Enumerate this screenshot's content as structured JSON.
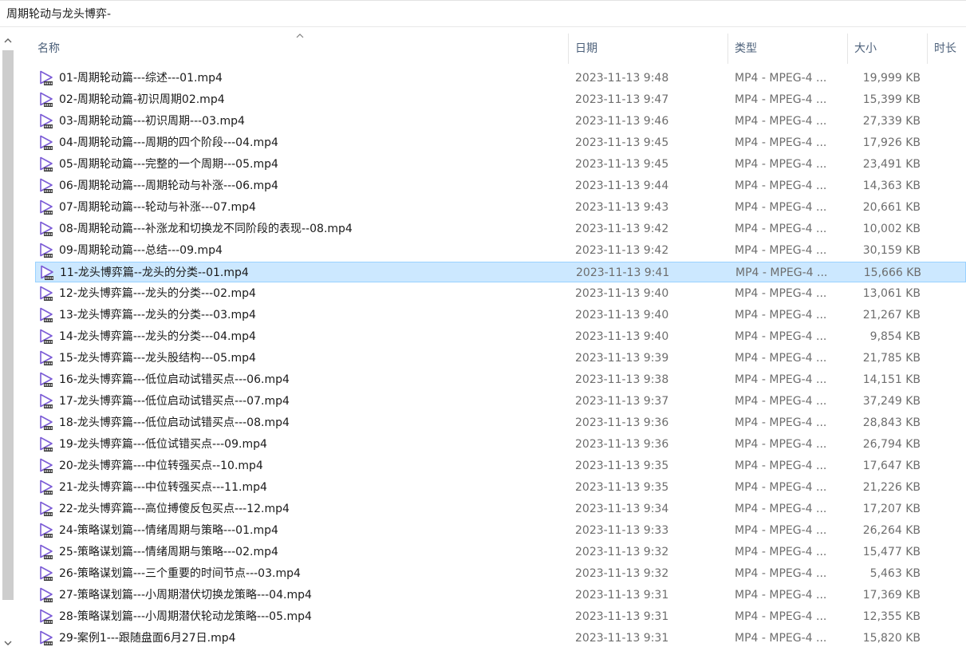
{
  "window": {
    "path_title": "周期轮动与龙头博弈-"
  },
  "columns": {
    "name": "名称",
    "date": "日期",
    "type": "类型",
    "size": "大小",
    "duration": "时长"
  },
  "colors": {
    "selected_bg": "#cce8ff",
    "selected_border": "#99d1ff",
    "header_text": "#4c607a",
    "icon_purple": "#7b5bd6"
  },
  "icons": {
    "file": "video-file-icon",
    "sort": "sort-up-arrow-icon",
    "scroll_up": "chevron-up-icon",
    "scroll_down": "chevron-down-icon"
  },
  "files": [
    {
      "name": "01-周期轮动篇---综述---01.mp4",
      "date": "2023-11-13 9:48",
      "type": "MP4 - MPEG-4 ...",
      "size": "19,999 KB"
    },
    {
      "name": "02-周期轮动篇-初识周期02.mp4",
      "date": "2023-11-13 9:47",
      "type": "MP4 - MPEG-4 ...",
      "size": "15,399 KB"
    },
    {
      "name": "03-周期轮动篇---初识周期---03.mp4",
      "date": "2023-11-13 9:46",
      "type": "MP4 - MPEG-4 ...",
      "size": "27,339 KB"
    },
    {
      "name": "04-周期轮动篇---周期的四个阶段---04.mp4",
      "date": "2023-11-13 9:45",
      "type": "MP4 - MPEG-4 ...",
      "size": "17,926 KB"
    },
    {
      "name": "05-周期轮动篇---完整的一个周期---05.mp4",
      "date": "2023-11-13 9:45",
      "type": "MP4 - MPEG-4 ...",
      "size": "23,491 KB"
    },
    {
      "name": "06-周期轮动篇---周期轮动与补涨---06.mp4",
      "date": "2023-11-13 9:44",
      "type": "MP4 - MPEG-4 ...",
      "size": "14,363 KB"
    },
    {
      "name": "07-周期轮动篇---轮动与补涨---07.mp4",
      "date": "2023-11-13 9:43",
      "type": "MP4 - MPEG-4 ...",
      "size": "20,661 KB"
    },
    {
      "name": "08-周期轮动篇---补涨龙和切换龙不同阶段的表现--08.mp4",
      "date": "2023-11-13 9:42",
      "type": "MP4 - MPEG-4 ...",
      "size": "10,002 KB"
    },
    {
      "name": "09-周期轮动篇---总结---09.mp4",
      "date": "2023-11-13 9:42",
      "type": "MP4 - MPEG-4 ...",
      "size": "30,159 KB"
    },
    {
      "name": "11-龙头博弈篇--龙头的分类--01.mp4",
      "date": "2023-11-13 9:41",
      "type": "MP4 - MPEG-4 ...",
      "size": "15,666 KB",
      "selected": true
    },
    {
      "name": "12-龙头博弈篇---龙头的分类---02.mp4",
      "date": "2023-11-13 9:40",
      "type": "MP4 - MPEG-4 ...",
      "size": "13,061 KB"
    },
    {
      "name": "13-龙头博弈篇---龙头的分类---03.mp4",
      "date": "2023-11-13 9:40",
      "type": "MP4 - MPEG-4 ...",
      "size": "21,267 KB"
    },
    {
      "name": "14-龙头博弈篇---龙头的分类---04.mp4",
      "date": "2023-11-13 9:40",
      "type": "MP4 - MPEG-4 ...",
      "size": "9,854 KB"
    },
    {
      "name": "15-龙头博弈篇---龙头股结构---05.mp4",
      "date": "2023-11-13 9:39",
      "type": "MP4 - MPEG-4 ...",
      "size": "21,785 KB"
    },
    {
      "name": "16-龙头博弈篇---低位启动试错买点---06.mp4",
      "date": "2023-11-13 9:38",
      "type": "MP4 - MPEG-4 ...",
      "size": "14,151 KB"
    },
    {
      "name": "17-龙头博弈篇---低位启动试错买点---07.mp4",
      "date": "2023-11-13 9:37",
      "type": "MP4 - MPEG-4 ...",
      "size": "37,249 KB"
    },
    {
      "name": "18-龙头博弈篇---低位启动试错买点---08.mp4",
      "date": "2023-11-13 9:36",
      "type": "MP4 - MPEG-4 ...",
      "size": "28,843 KB"
    },
    {
      "name": "19-龙头博弈篇---低位试错买点---09.mp4",
      "date": "2023-11-13 9:36",
      "type": "MP4 - MPEG-4 ...",
      "size": "26,794 KB"
    },
    {
      "name": "20-龙头博弈篇---中位转强买点--10.mp4",
      "date": "2023-11-13 9:35",
      "type": "MP4 - MPEG-4 ...",
      "size": "17,647 KB"
    },
    {
      "name": "21-龙头博弈篇---中位转强买点---11.mp4",
      "date": "2023-11-13 9:35",
      "type": "MP4 - MPEG-4 ...",
      "size": "21,226 KB"
    },
    {
      "name": "22-龙头博弈篇---高位搏傻反包买点---12.mp4",
      "date": "2023-11-13 9:34",
      "type": "MP4 - MPEG-4 ...",
      "size": "17,207 KB"
    },
    {
      "name": "24-策略谋划篇---情绪周期与策略---01.mp4",
      "date": "2023-11-13 9:33",
      "type": "MP4 - MPEG-4 ...",
      "size": "26,264 KB"
    },
    {
      "name": "25-策略谋划篇---情绪周期与策略---02.mp4",
      "date": "2023-11-13 9:32",
      "type": "MP4 - MPEG-4 ...",
      "size": "15,477 KB"
    },
    {
      "name": "26-策略谋划篇---三个重要的时间节点---03.mp4",
      "date": "2023-11-13 9:32",
      "type": "MP4 - MPEG-4 ...",
      "size": "5,463 KB"
    },
    {
      "name": "27-策略谋划篇---小周期潜伏切换龙策略---04.mp4",
      "date": "2023-11-13 9:31",
      "type": "MP4 - MPEG-4 ...",
      "size": "17,369 KB"
    },
    {
      "name": "28-策略谋划篇---小周期潜伏轮动龙策略---05.mp4",
      "date": "2023-11-13 9:31",
      "type": "MP4 - MPEG-4 ...",
      "size": "12,355 KB"
    },
    {
      "name": "29-案例1---跟随盘面6月27日.mp4",
      "date": "2023-11-13 9:31",
      "type": "MP4 - MPEG-4 ...",
      "size": "15,820 KB"
    }
  ]
}
